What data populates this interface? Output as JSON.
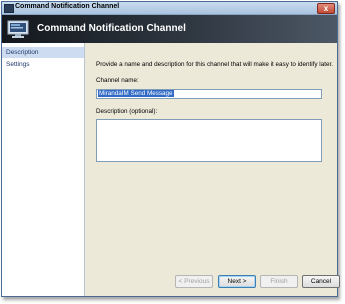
{
  "window": {
    "title": "Command Notification Channel",
    "close_label": "x"
  },
  "header": {
    "title": "Command Notification Channel",
    "icon": "channel-monitor-icon"
  },
  "sidebar": {
    "items": [
      {
        "label": "Description",
        "selected": true
      },
      {
        "label": "Settings",
        "selected": false
      }
    ]
  },
  "main": {
    "instruction": "Provide a name and description for this channel that will make it easy to identify later.",
    "channel_name": {
      "label": "Channel name:",
      "value": "MirandaIM Send Message"
    },
    "description": {
      "label": "Description (optional):",
      "value": ""
    }
  },
  "buttons": {
    "previous": "< Previous",
    "next": "Next >",
    "finish": "Finish",
    "cancel": "Cancel"
  },
  "colors": {
    "selection": "#316ac5",
    "sidebar_selected": "#cddcf0",
    "header_dark": "#14181d"
  }
}
